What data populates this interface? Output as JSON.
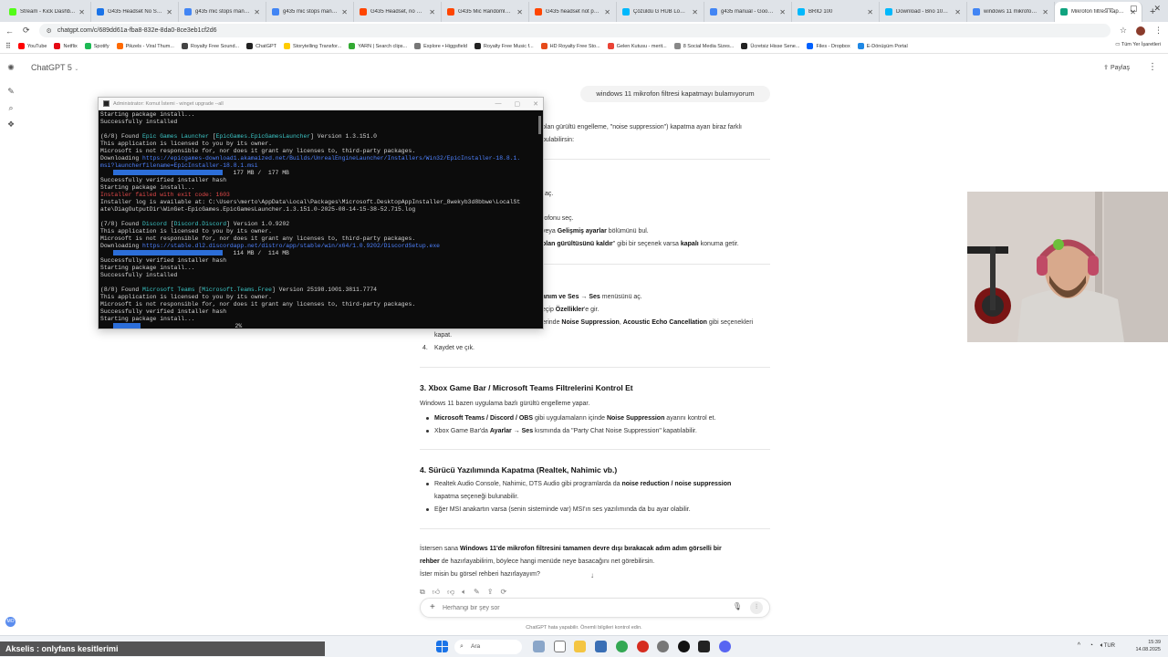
{
  "browser": {
    "tabs": [
      {
        "title": "Stream - Kick Dashb...",
        "color": "#53fc18",
        "active": false
      },
      {
        "title": "G435 Headset No Sou...",
        "color": "#1a73e8",
        "active": false
      },
      {
        "title": "g435 mic stops manua...",
        "color": "#4285f4",
        "active": false
      },
      {
        "title": "g435 mic stops manu...",
        "color": "#4285f4",
        "active": false
      },
      {
        "title": "G435 Headset, no mi...",
        "color": "#ff4500",
        "active": false
      },
      {
        "title": "G435 Mic Randomly B...",
        "color": "#ff4500",
        "active": false
      },
      {
        "title": "G435 headset not pair...",
        "color": "#ff4500",
        "active": false
      },
      {
        "title": "Çözüldü G HUB Login...",
        "color": "#00b8fc",
        "active": false
      },
      {
        "title": "g435 manual - Google...",
        "color": "#4285f4",
        "active": false
      },
      {
        "title": "BRIO 100",
        "color": "#00b8fc",
        "active": false
      },
      {
        "title": "Download - Brio 100 ...",
        "color": "#00b8fc",
        "active": false
      },
      {
        "title": "windows 11 mikrofon ...",
        "color": "#4285f4",
        "active": false
      },
      {
        "title": "Mikrofon filtresi kapat...",
        "color": "#10a37f",
        "active": true
      }
    ],
    "new_tab": "+",
    "window_controls": [
      "—",
      "▢",
      "✕"
    ],
    "url": "chatgpt.com/c/689dd61a-fba8-832e-8da0-8ce3eb1cf2d6",
    "bookmarks": [
      {
        "label": "YouTube",
        "color": "#ff0000"
      },
      {
        "label": "Netflix",
        "color": "#e50914"
      },
      {
        "label": "Spotify",
        "color": "#1db954"
      },
      {
        "label": "Pikzels - Viral Thum...",
        "color": "#ff6a00"
      },
      {
        "label": "Royalty Free Sound...",
        "color": "#444444"
      },
      {
        "label": "ChatGPT",
        "color": "#222222"
      },
      {
        "label": "Storytelling Transfor...",
        "color": "#ffcc00"
      },
      {
        "label": "YARN | Search clips...",
        "color": "#33aa33"
      },
      {
        "label": "Explore • Higgsfield",
        "color": "#777777"
      },
      {
        "label": "Royalty Free Music f...",
        "color": "#222222"
      },
      {
        "label": "HD Royalty Free Sto...",
        "color": "#e64a19"
      },
      {
        "label": "Gelen Kutusu - merit...",
        "color": "#ea4335"
      },
      {
        "label": "8 Social Media Sizes...",
        "color": "#888888"
      },
      {
        "label": "Ücretsiz Hisse Sene...",
        "color": "#222222"
      },
      {
        "label": "Files - Dropbox",
        "color": "#0061ff"
      },
      {
        "label": "E-Dönüşüm Portal",
        "color": "#1e88e5"
      }
    ],
    "all_bookmarks": "Tüm Yer İşaretleri"
  },
  "app": {
    "model": "ChatGPT 5",
    "share": "Paylaş",
    "user_message": "windows 11 mikrofon filtresi kapatmayı bulamıyorum",
    "composer_placeholder": "Herhangi bir şey sor",
    "disclaimer": "ChatGPT hata yapabilir. Önemli bilgileri kontrol edin."
  },
  "assistant": {
    "frag_intro_1": "olan gürültü engelleme, \"noise suppression\") kapatma ayarı biraz farklı",
    "frag_intro_2": "bulabilirsin:",
    "frag_ac": "aç.",
    "frag_mic": "rofonu seç.",
    "frag_adv_pre": "veya ",
    "frag_adv_b": "Gelişmiş ayarlar",
    "frag_adv_post": " bölümünü bul.",
    "frag_noise_b": "olan gürültüsünü kaldır",
    "frag_noise_mid": "\" gibi bir seçenek varsa ",
    "frag_noise_b2": "kapalı",
    "frag_noise_post": " konuma getir.",
    "frag_ses_b": "anım ve Ses → Ses",
    "frag_ses_post": " menüsünü aç.",
    "frag_ozel_pre": "eçip ",
    "frag_ozel_b": "Özellikler",
    "frag_ozel_post": "'e gir.",
    "frag_ns_pre": "erinde ",
    "frag_ns_b1": "Noise Suppression",
    "frag_ns_mid": ", ",
    "frag_ns_b2": "Acoustic Echo Cancellation",
    "frag_ns_post": " gibi seçenekleri",
    "frag_kapat": "kapat.",
    "step4_num": "4.",
    "step4_text": "Kaydet ve çık.",
    "section3_title": "3. Xbox Game Bar / Microsoft Teams Filtrelerini Kontrol Et",
    "section3_intro": "Windows 11 bazen uygulama bazlı gürültü engelleme yapar.",
    "s3_b1_b": "Microsoft Teams / Discord / OBS",
    "s3_b1_mid": " gibi uygulamaların içinde ",
    "s3_b1_b2": "Noise Suppression",
    "s3_b1_post": " ayarını kontrol et.",
    "s3_b2_pre": "Xbox Game Bar'da ",
    "s3_b2_b": "Ayarlar → Ses",
    "s3_b2_post": " kısmında da \"Party Chat Noise Suppression\" kapatılabilir.",
    "section4_title": "4. Sürücü Yazılımında Kapatma (Realtek, Nahimic vb.)",
    "s4_b1_pre": "Realtek Audio Console, Nahimic, DTS Audio gibi programlarda da ",
    "s4_b1_b": "noise reduction / noise suppression",
    "s4_b1_line2": "kapatma seçeneği bulunabilir.",
    "s4_b2": "Eğer MSI anakartın varsa (senin sisteminde var) MSI'ın ses yazılımında da bu ayar olabilir.",
    "outro_pre": "İstersen sana ",
    "outro_b": "Windows 11'de mikrofon filtresini tamamen devre dışı bırakacak adım adım görselli bir",
    "outro_b2": "rehber",
    "outro_post": " de hazırlayabilirim, böylece hangi menüde neye basacağını net görebilirsin.",
    "outro_q": "İster misin bu görsel rehberi hazırlayayım?"
  },
  "terminal": {
    "title": "Administrator: Komut İstemi - winget upgrade --all",
    "lines": [
      {
        "parts": [
          [
            "Starting package install...",
            ""
          ]
        ]
      },
      {
        "parts": [
          [
            "Successfully installed",
            ""
          ]
        ]
      },
      {
        "parts": [
          [
            "",
            ""
          ]
        ]
      },
      {
        "parts": [
          [
            "(6/8) Found ",
            ""
          ],
          [
            "Epic Games Launcher",
            "cy"
          ],
          [
            " [",
            ""
          ],
          [
            "EpicGames.EpicGamesLauncher",
            "cy"
          ],
          [
            "] Version 1.3.151.0",
            ""
          ]
        ]
      },
      {
        "parts": [
          [
            "This application is licensed to you by its owner.",
            ""
          ]
        ]
      },
      {
        "parts": [
          [
            "Microsoft is not responsible for, nor does it grant any licenses to, third-party packages.",
            ""
          ]
        ]
      },
      {
        "parts": [
          [
            "Downloading ",
            ""
          ],
          [
            "https://epicgames-download1.akamaized.net/Builds/UnrealEngineLauncher/Installers/Win32/EpicInstaller-18.8.1.",
            "lk"
          ]
        ]
      },
      {
        "parts": [
          [
            "msi?launcherfilename=EpicInstaller-18.8.1.msi",
            "lk"
          ]
        ]
      },
      {
        "bar": 120,
        "parts": [
          [
            "   177 MB /  177 MB",
            ""
          ]
        ]
      },
      {
        "parts": [
          [
            "Successfully verified installer hash",
            ""
          ]
        ]
      },
      {
        "parts": [
          [
            "Starting package install...",
            ""
          ]
        ]
      },
      {
        "parts": [
          [
            "Installer failed with exit code: 1603",
            "rd"
          ]
        ]
      },
      {
        "parts": [
          [
            "Installer log is available at: C:\\Users\\merto\\AppData\\Local\\Packages\\Microsoft.DesktopAppInstaller_8wekyb3d8bbwe\\LocalSt",
            ""
          ]
        ]
      },
      {
        "parts": [
          [
            "ate\\DiagOutputDir\\WinGet-EpicGames.EpicGamesLauncher.1.3.151.0-2025-08-14-15-38-52.715.log",
            ""
          ]
        ]
      },
      {
        "parts": [
          [
            "",
            ""
          ]
        ]
      },
      {
        "parts": [
          [
            "(7/8) Found ",
            ""
          ],
          [
            "Discord",
            "cy"
          ],
          [
            " [",
            ""
          ],
          [
            "Discord.Discord",
            "cy"
          ],
          [
            "] Version 1.0.9202",
            ""
          ]
        ]
      },
      {
        "parts": [
          [
            "This application is licensed to you by its owner.",
            ""
          ]
        ]
      },
      {
        "parts": [
          [
            "Microsoft is not responsible for, nor does it grant any licenses to, third-party packages.",
            ""
          ]
        ]
      },
      {
        "parts": [
          [
            "Downloading ",
            ""
          ],
          [
            "https://stable.dl2.discordapp.net/distro/app/stable/win/x64/1.0.9202/DiscordSetup.exe",
            "lk"
          ]
        ]
      },
      {
        "bar": 120,
        "parts": [
          [
            "   114 MB /  114 MB",
            ""
          ]
        ]
      },
      {
        "parts": [
          [
            "Successfully verified installer hash",
            ""
          ]
        ]
      },
      {
        "parts": [
          [
            "Starting package install...",
            ""
          ]
        ]
      },
      {
        "parts": [
          [
            "Successfully installed",
            ""
          ]
        ]
      },
      {
        "parts": [
          [
            "",
            ""
          ]
        ]
      },
      {
        "parts": [
          [
            "(8/8) Found ",
            ""
          ],
          [
            "Microsoft Teams",
            "cy"
          ],
          [
            " [",
            ""
          ],
          [
            "Microsoft.Teams.Free",
            "cy"
          ],
          [
            "] Version 25198.1001.3811.7774",
            ""
          ]
        ]
      },
      {
        "parts": [
          [
            "This application is licensed to you by its owner.",
            ""
          ]
        ]
      },
      {
        "parts": [
          [
            "Microsoft is not responsible for, nor does it grant any licenses to, third-party packages.",
            ""
          ]
        ]
      },
      {
        "parts": [
          [
            "Successfully verified installer hash",
            ""
          ]
        ]
      },
      {
        "parts": [
          [
            "Starting package install...",
            ""
          ]
        ]
      },
      {
        "bar": 30,
        "parts": [
          [
            "                           2%",
            ""
          ]
        ]
      }
    ]
  },
  "taskbar": {
    "search": "Ara",
    "lang": "TUR",
    "time": "15:39",
    "date": "14.08.2025"
  },
  "overlay": {
    "caption": "Akselis : onlyfans kesitlerimi"
  },
  "colors": {
    "accent": "#10a37f",
    "terminal_bg": "#0c0c0c",
    "progress": "#2c6ed8"
  }
}
